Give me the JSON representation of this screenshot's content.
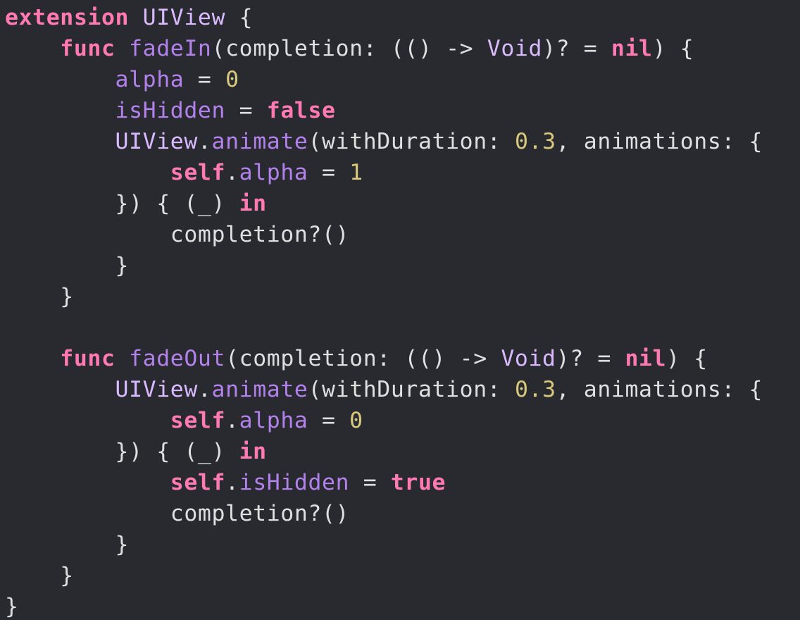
{
  "colors": {
    "background": "#292a30",
    "plain": "#dfdfe0",
    "keyword": "#ff7ab2",
    "type": "#dabaff",
    "function_or_property": "#b281eb",
    "number": "#d9c97c"
  },
  "code_lines": [
    [
      [
        "kw",
        "extension"
      ],
      [
        "plain",
        " "
      ],
      [
        "type",
        "UIView"
      ],
      [
        "plain",
        " {"
      ]
    ],
    [
      [
        "plain",
        "    "
      ],
      [
        "kw",
        "func"
      ],
      [
        "plain",
        " "
      ],
      [
        "func",
        "fadeIn"
      ],
      [
        "plain",
        "(completion: (() -> "
      ],
      [
        "type",
        "Void"
      ],
      [
        "plain",
        ")? = "
      ],
      [
        "kw",
        "nil"
      ],
      [
        "plain",
        ") {"
      ]
    ],
    [
      [
        "plain",
        "        "
      ],
      [
        "prop",
        "alpha"
      ],
      [
        "plain",
        " = "
      ],
      [
        "num",
        "0"
      ]
    ],
    [
      [
        "plain",
        "        "
      ],
      [
        "prop",
        "isHidden"
      ],
      [
        "plain",
        " = "
      ],
      [
        "kw",
        "false"
      ]
    ],
    [
      [
        "plain",
        "        "
      ],
      [
        "type",
        "UIView"
      ],
      [
        "plain",
        "."
      ],
      [
        "func",
        "animate"
      ],
      [
        "plain",
        "(withDuration: "
      ],
      [
        "num",
        "0.3"
      ],
      [
        "plain",
        ", animations: {"
      ]
    ],
    [
      [
        "plain",
        "            "
      ],
      [
        "kw",
        "self"
      ],
      [
        "plain",
        "."
      ],
      [
        "prop",
        "alpha"
      ],
      [
        "plain",
        " = "
      ],
      [
        "num",
        "1"
      ]
    ],
    [
      [
        "plain",
        "        }) { (_) "
      ],
      [
        "kw",
        "in"
      ]
    ],
    [
      [
        "plain",
        "            completion?()"
      ]
    ],
    [
      [
        "plain",
        "        }"
      ]
    ],
    [
      [
        "plain",
        "    }"
      ]
    ],
    [
      [
        "plain",
        ""
      ]
    ],
    [
      [
        "plain",
        "    "
      ],
      [
        "kw",
        "func"
      ],
      [
        "plain",
        " "
      ],
      [
        "func",
        "fadeOut"
      ],
      [
        "plain",
        "(completion: (() -> "
      ],
      [
        "type",
        "Void"
      ],
      [
        "plain",
        ")? = "
      ],
      [
        "kw",
        "nil"
      ],
      [
        "plain",
        ") {"
      ]
    ],
    [
      [
        "plain",
        "        "
      ],
      [
        "type",
        "UIView"
      ],
      [
        "plain",
        "."
      ],
      [
        "func",
        "animate"
      ],
      [
        "plain",
        "(withDuration: "
      ],
      [
        "num",
        "0.3"
      ],
      [
        "plain",
        ", animations: {"
      ]
    ],
    [
      [
        "plain",
        "            "
      ],
      [
        "kw",
        "self"
      ],
      [
        "plain",
        "."
      ],
      [
        "prop",
        "alpha"
      ],
      [
        "plain",
        " = "
      ],
      [
        "num",
        "0"
      ]
    ],
    [
      [
        "plain",
        "        }) { (_) "
      ],
      [
        "kw",
        "in"
      ]
    ],
    [
      [
        "plain",
        "            "
      ],
      [
        "kw",
        "self"
      ],
      [
        "plain",
        "."
      ],
      [
        "prop",
        "isHidden"
      ],
      [
        "plain",
        " = "
      ],
      [
        "kw",
        "true"
      ]
    ],
    [
      [
        "plain",
        "            completion?()"
      ]
    ],
    [
      [
        "plain",
        "        }"
      ]
    ],
    [
      [
        "plain",
        "    }"
      ]
    ],
    [
      [
        "plain",
        "}"
      ]
    ]
  ]
}
